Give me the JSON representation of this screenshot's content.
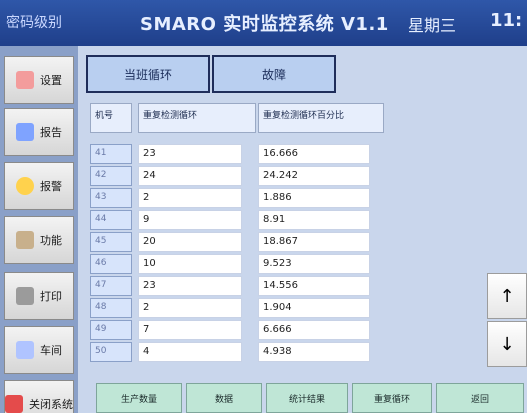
{
  "window": {
    "left_label": "密码级别",
    "title": "SMARO 实时监控系统 V1.1",
    "day_label": "星期三",
    "time_partial": "11:"
  },
  "menu": [
    {
      "label": "设置",
      "icon": "hand-pointer-icon",
      "color": "#f39c9c"
    },
    {
      "label": "报告",
      "icon": "report-book-icon",
      "color": "#7fa3ff"
    },
    {
      "label": "报警",
      "icon": "lightbulb-icon",
      "color": "#ffd24d"
    },
    {
      "label": "功能",
      "icon": "map-icon",
      "color": "#c8b08c"
    },
    {
      "label": "打印",
      "icon": "printer-icon",
      "color": "#9b9b9b"
    },
    {
      "label": "车间",
      "icon": "tools-icon",
      "color": "#b0c4ff"
    },
    {
      "label": "关闭系统",
      "icon": "power-icon",
      "color": "#e44b4b"
    }
  ],
  "tabs": [
    {
      "label": "当班循环"
    },
    {
      "label": "故障"
    }
  ],
  "table": {
    "headers": {
      "no": "机号",
      "cycle": "重复检测循环",
      "percent": "重复检测循环百分比"
    },
    "rows": [
      {
        "no": "41",
        "cycle": "23",
        "percent": "16.666"
      },
      {
        "no": "42",
        "cycle": "24",
        "percent": "24.242"
      },
      {
        "no": "43",
        "cycle": "2",
        "percent": "1.886"
      },
      {
        "no": "44",
        "cycle": "9",
        "percent": "8.91"
      },
      {
        "no": "45",
        "cycle": "20",
        "percent": "18.867"
      },
      {
        "no": "46",
        "cycle": "10",
        "percent": "9.523"
      },
      {
        "no": "47",
        "cycle": "23",
        "percent": "14.556"
      },
      {
        "no": "48",
        "cycle": "2",
        "percent": "1.904"
      },
      {
        "no": "49",
        "cycle": "7",
        "percent": "6.666"
      },
      {
        "no": "50",
        "cycle": "4",
        "percent": "4.938"
      }
    ]
  },
  "arrows": {
    "up": "↑",
    "down": "↓"
  },
  "bottom_buttons": [
    {
      "label": "生产数量"
    },
    {
      "label": "数据"
    },
    {
      "label": "统计结果"
    },
    {
      "label": "重复循环"
    },
    {
      "label": "返回"
    }
  ]
}
